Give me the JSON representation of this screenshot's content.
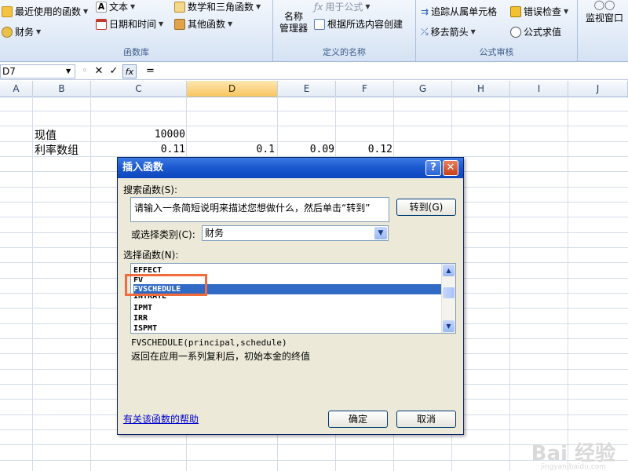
{
  "ribbon": {
    "function_library": {
      "recent": "最近使用的函数",
      "financial": "财务",
      "text": "文本",
      "datetime": "日期和时间",
      "math": "数学和三角函数",
      "other": "其他函数",
      "label": "函数库"
    },
    "defined_names": {
      "name_manager_line1": "名称",
      "name_manager_line2": "管理器",
      "use_in_formula": "用于公式",
      "create_from_selection": "根据所选内容创建",
      "label": "定义的名称"
    },
    "formula_auditing": {
      "trace_dependents": "追踪从属单元格",
      "remove_arrows": "移去箭头",
      "error_checking": "错误检查",
      "evaluate_formula": "公式求值",
      "label": "公式审核"
    },
    "watch_window": "监视窗口"
  },
  "formula_bar": {
    "name_box": "D7",
    "content": "="
  },
  "columns": [
    "A",
    "B",
    "C",
    "D",
    "E",
    "F",
    "G",
    "H",
    "I",
    "J"
  ],
  "cells": {
    "b_pv": "现值",
    "c_pv": "10000",
    "b_rates": "利率数组",
    "c_rate": "0.11",
    "d_rate": "0.1",
    "e_rate": "0.09",
    "f_rate": "0.12"
  },
  "dialog": {
    "title": "插入函数",
    "help_button": "?",
    "close_button": "✕",
    "search_label": "搜索函数(S):",
    "search_value": "请输入一条简短说明来描述您想做什么，然后单击“转到”",
    "go_button": "转到(G)",
    "category_label": "或选择类别(C):",
    "category_value": "财务",
    "select_label": "选择函数(N):",
    "functions": [
      "EFFECT",
      "FV",
      "FVSCHEDULE",
      "INTRATE",
      "IPMT",
      "IRR",
      "ISPMT"
    ],
    "selected_function": "FVSCHEDULE",
    "signature": "FVSCHEDULE(principal,schedule)",
    "description": "返回在应用一系列复利后，初始本金的终值",
    "help_link": "有关该函数的帮助",
    "ok_button": "确定",
    "cancel_button": "取消"
  },
  "watermark": {
    "logo": "Bai 经验",
    "url": "jingyan.baidu.com"
  },
  "colors": {
    "selected_row": "#316ac5",
    "highlight_box": "#f26b3a",
    "title_bar": "#1c5ad0"
  }
}
